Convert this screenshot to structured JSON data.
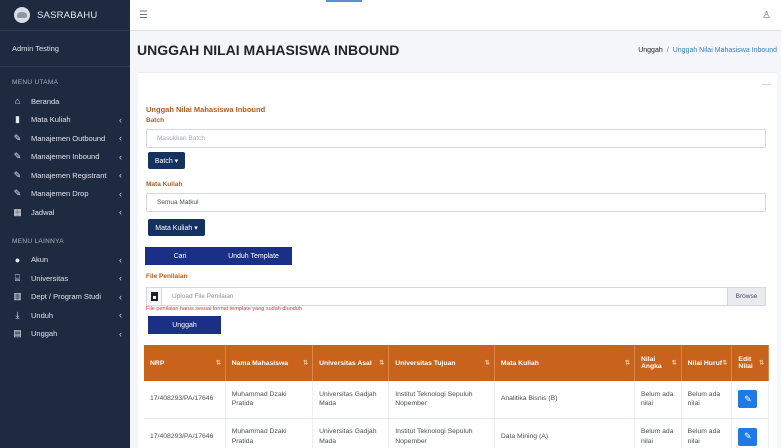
{
  "brand": {
    "name": "SASRABAHU"
  },
  "user": {
    "name": "Admin Testing"
  },
  "sidebar": {
    "section1": "MENU UTAMA",
    "items1": [
      {
        "label": "Beranda",
        "icon": "home-icon",
        "glyph": "⌂",
        "chevron": ""
      },
      {
        "label": "Mata Kuliah",
        "icon": "book-icon",
        "glyph": "▮",
        "chevron": "‹"
      },
      {
        "label": "Manajemen Outbound",
        "icon": "edit-icon",
        "glyph": "✎",
        "chevron": "‹"
      },
      {
        "label": "Manajemen Inbound",
        "icon": "edit-icon",
        "glyph": "✎",
        "chevron": "‹"
      },
      {
        "label": "Manajemen Registrant",
        "icon": "edit-icon",
        "glyph": "✎",
        "chevron": "‹"
      },
      {
        "label": "Manajemen Drop",
        "icon": "edit-icon",
        "glyph": "✎",
        "chevron": "‹"
      },
      {
        "label": "Jadwal",
        "icon": "calendar-icon",
        "glyph": "▦",
        "chevron": "‹"
      }
    ],
    "section2": "MENU LAINNYA",
    "items2": [
      {
        "label": "Akun",
        "icon": "user-circle-icon",
        "glyph": "●",
        "chevron": "‹"
      },
      {
        "label": "Universitas",
        "icon": "university-icon",
        "glyph": "⌸",
        "chevron": "‹"
      },
      {
        "label": "Dept / Program Studi",
        "icon": "building-icon",
        "glyph": "▥",
        "chevron": "‹"
      },
      {
        "label": "Unduh",
        "icon": "download-icon",
        "glyph": "⤓",
        "chevron": "‹"
      },
      {
        "label": "Unggah",
        "icon": "file-upload-icon",
        "glyph": "▤",
        "chevron": "‹"
      }
    ]
  },
  "header": {
    "title": "UNGGAH NILAI MAHASISWA INBOUND",
    "breadcrumb": {
      "root": "Unggah",
      "separator": "/",
      "active": "Unggah Nilai Mahasiswa Inbound"
    }
  },
  "form": {
    "title": "Unggah Nilai Mahasiswa Inbound",
    "batch_label": "Batch",
    "batch_placeholder": "Masukkan Batch",
    "batch_button": "Batch ▾",
    "matkul_label": "Mata Kuliah",
    "matkul_value": "Semua Matkul",
    "matkul_button": "Mata Kuliah ▾",
    "search_button": "Cari",
    "template_button": "Unduh Template",
    "file_label": "File Penilaian",
    "file_placeholder": "Upload File Penilaian",
    "browse_button": "Browse",
    "file_hint": "File penilaian harus sesuai format template yang sudah diunduh",
    "upload_button": "Unggah"
  },
  "table": {
    "headers": [
      "NRP",
      "Nama Mahasiswa",
      "Universitas Asal",
      "Universitas Tujuan",
      "Mata Kuliah",
      "Nilai Angka",
      "Nilai Huruf",
      "Edit Nilai"
    ],
    "rows": [
      [
        "17/408293/PA/17646",
        "Muhammad Dzaki Pratida",
        "Universitas Gadjah Mada",
        "Institut Teknologi Sepuluh Nopember",
        "Analitika Bisnis (B)",
        "Belum ada nilai",
        "Belum ada nilai"
      ],
      [
        "17/408293/PA/17646",
        "Muhammad Dzaki Pratida",
        "Universitas Gadjah Mada",
        "Institut Teknologi Sepuluh Nopember",
        "Data Mining (A)",
        "Belum ada nilai",
        "Belum ada nilai"
      ]
    ]
  },
  "colors": {
    "sidebar": "#1e2a3f",
    "accent": "#c9621a",
    "button_dark": "#14315f",
    "button_primary": "#1a2f86",
    "edit": "#1f7ae8"
  }
}
